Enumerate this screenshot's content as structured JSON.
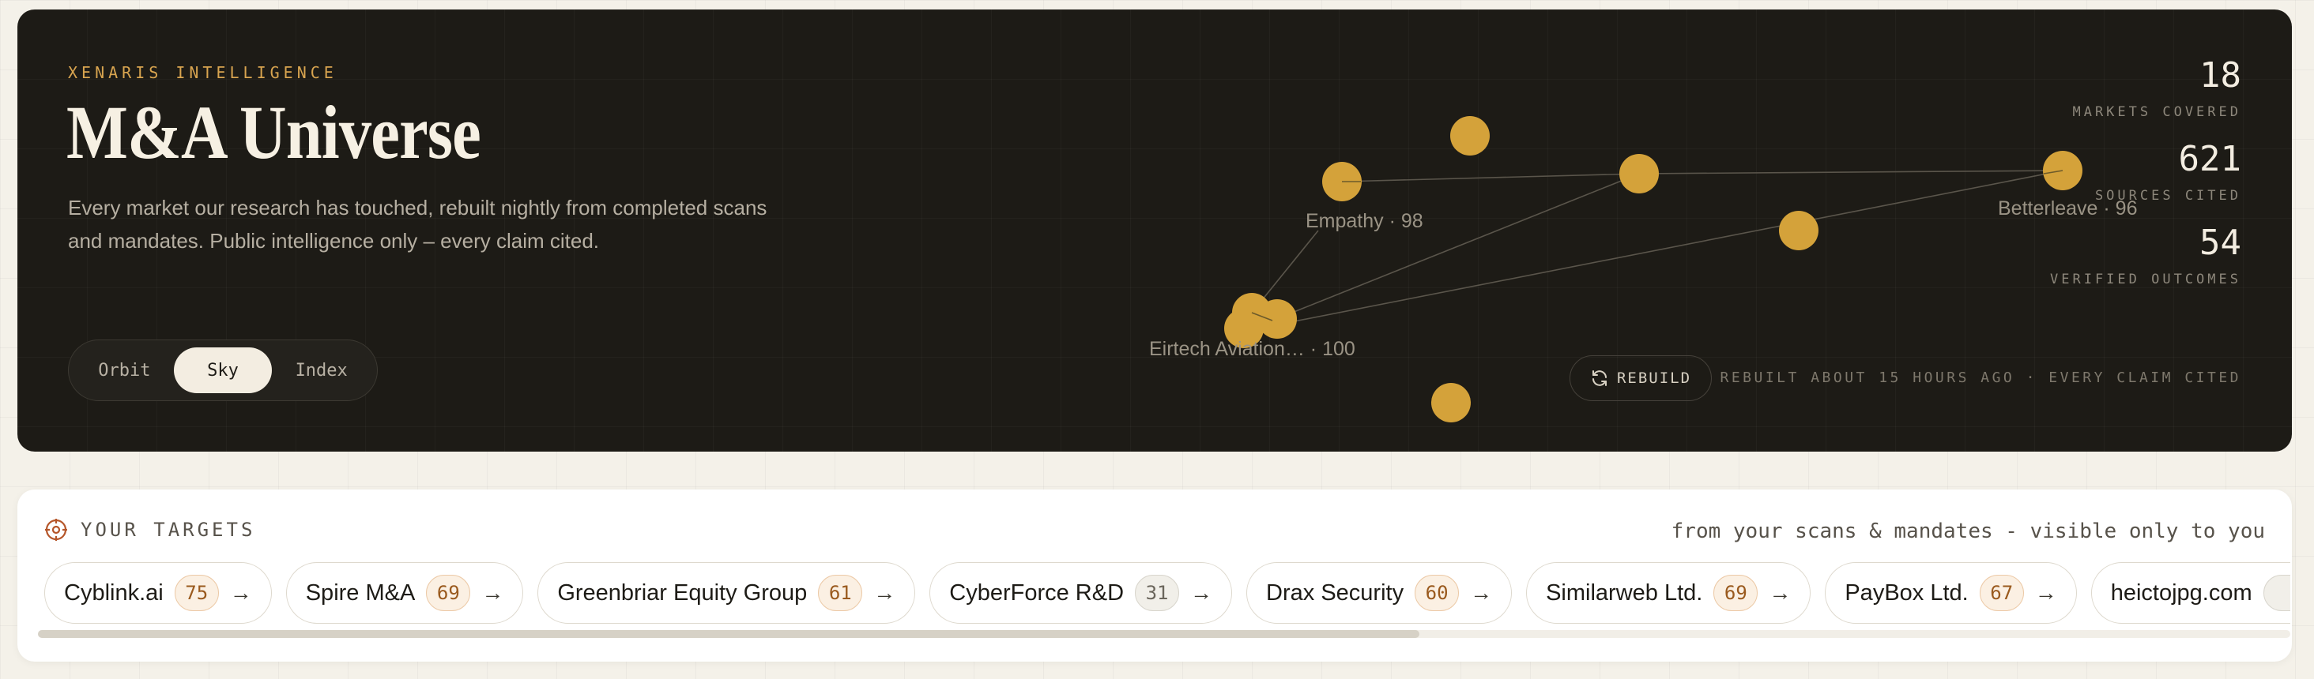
{
  "hero": {
    "eyebrow": "XENARIS INTELLIGENCE",
    "title": "M&A Universe",
    "subtitle": "Every market our research has touched, rebuilt nightly from completed scans and mandates. Public intelligence only – every claim cited.",
    "modes": [
      "Orbit",
      "Sky",
      "Index"
    ],
    "active_mode": "Sky",
    "stats": [
      {
        "value": "18",
        "label": "MARKETS COVERED"
      },
      {
        "value": "621",
        "label": "SOURCES CITED"
      },
      {
        "value": "54",
        "label": "VERIFIED OUTCOMES"
      }
    ],
    "rebuild_label": "REBUILD",
    "rebuild_meta": "REBUILT ABOUT 15 HOURS AGO · EVERY CLAIM CITED",
    "node_labels": {
      "empathy": "Empathy · 98",
      "betterleave": "Betterleave · 96",
      "eirtech": "Eirtech Aviation… · 100"
    },
    "colors": {
      "node": "#d4a23a",
      "background": "#1d1b16",
      "accent": "#d9a550"
    }
  },
  "targets": {
    "title": "YOUR TARGETS",
    "note": "from your scans & mandates - visible only to you",
    "items": [
      {
        "name": "Cyblink.ai",
        "score": "75"
      },
      {
        "name": "Spire M&A",
        "score": "69"
      },
      {
        "name": "Greenbriar Equity Group",
        "score": "61"
      },
      {
        "name": "CyberForce R&D",
        "score": "31"
      },
      {
        "name": "Drax Security",
        "score": "60"
      },
      {
        "name": "Similarweb Ltd.",
        "score": "69"
      },
      {
        "name": "PayBox Ltd.",
        "score": "67"
      },
      {
        "name": "heictojpg.com",
        "score": ""
      }
    ],
    "scroll_position": 0.61
  }
}
